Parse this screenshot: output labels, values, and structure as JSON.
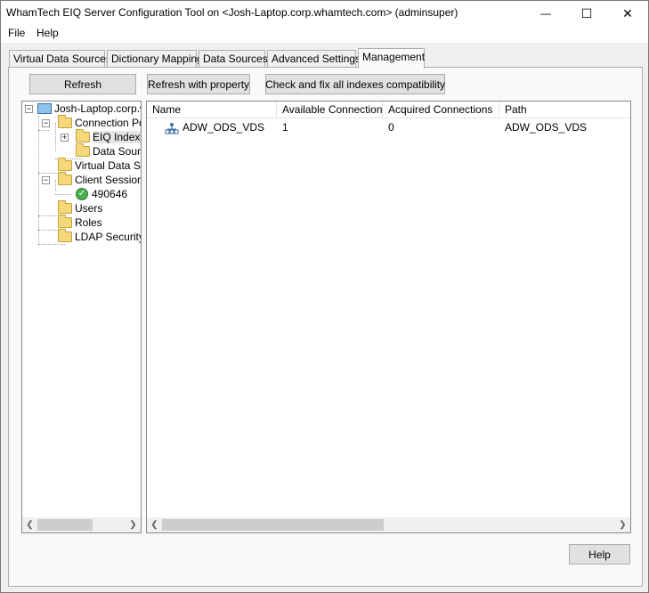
{
  "window": {
    "title": "WhamTech EIQ Server Configuration Tool on <Josh-Laptop.corp.whamtech.com> (adminsuper)",
    "controls": {
      "minimize": "—",
      "maximize": "☐",
      "close": "✕"
    }
  },
  "menu": [
    "File",
    "Help"
  ],
  "tabs": [
    "Virtual Data Sources",
    "Dictionary Mapping",
    "Data Sources",
    "Advanced Settings",
    "Management"
  ],
  "active_tab": "Management",
  "toolbar": {
    "refresh": "Refresh",
    "refresh_with_property": "Refresh with property",
    "check_fix": "Check and fix all indexes compatibility"
  },
  "tree": {
    "root": "Josh-Laptop.corp.whamtech.com",
    "connection_pools": "Connection Pools",
    "eiq_indexes": "EIQ Indexes",
    "data_sources": "Data Sources",
    "virtual_data_sources": "Virtual Data Sources",
    "client_sessions": "Client Sessions",
    "session_id": "490646",
    "users": "Users",
    "roles": "Roles",
    "ldap_security": "LDAP Security"
  },
  "list": {
    "columns": [
      "Name",
      "Available Connections",
      "Acquired Connections",
      "Path"
    ],
    "rows": [
      {
        "name": "ADW_ODS_VDS",
        "available": "1",
        "acquired": "0",
        "path": "ADW_ODS_VDS"
      }
    ]
  },
  "footer": {
    "help": "Help"
  },
  "colors": {
    "accent": "#0078d7",
    "folder": "#f5d87a",
    "session_ok": "#4caf50"
  }
}
